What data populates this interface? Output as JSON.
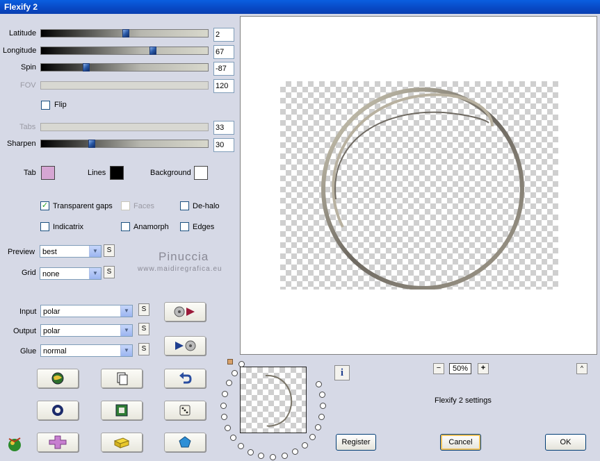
{
  "window": {
    "title": "Flexify 2"
  },
  "sliders": [
    {
      "label": "Latitude",
      "value": "2",
      "position": 0.52,
      "enabled": true
    },
    {
      "label": "Longitude",
      "value": "67",
      "position": 0.68,
      "enabled": true
    },
    {
      "label": "Spin",
      "value": "-87",
      "position": 0.27,
      "enabled": true
    },
    {
      "label": "FOV",
      "value": "120",
      "enabled": false
    },
    {
      "label": "Tabs",
      "value": "33",
      "enabled": false
    },
    {
      "label": "Sharpen",
      "value": "30",
      "position": 0.3,
      "enabled": true
    }
  ],
  "flip": {
    "label": "Flip",
    "checked": false
  },
  "colors": {
    "tab": {
      "label": "Tab",
      "color": "#d6a6d3"
    },
    "lines": {
      "label": "Lines",
      "color": "#000000"
    },
    "background": {
      "label": "Background",
      "color": "#ffffff"
    }
  },
  "options": {
    "transparent_gaps": {
      "label": "Transparent gaps",
      "checked": true
    },
    "faces": {
      "label": "Faces",
      "checked": false,
      "enabled": false
    },
    "de_halo": {
      "label": "De-halo",
      "checked": false
    },
    "indicatrix": {
      "label": "Indicatrix",
      "checked": false
    },
    "anamorph": {
      "label": "Anamorph",
      "checked": false
    },
    "edges": {
      "label": "Edges",
      "checked": false
    }
  },
  "dropdowns": {
    "preview": {
      "label": "Preview",
      "value": "best"
    },
    "grid": {
      "label": "Grid",
      "value": "none"
    },
    "input": {
      "label": "Input",
      "value": "polar"
    },
    "output": {
      "label": "Output",
      "value": "polar"
    },
    "glue": {
      "label": "Glue",
      "value": "normal"
    }
  },
  "small_button_label": "S",
  "watermark": {
    "name": "Pinuccia",
    "site": "www.maidiregrafica.eu"
  },
  "zoom": {
    "minus": "−",
    "value": "50%",
    "plus": "+"
  },
  "settings_label": "Flexify 2 settings",
  "info_label": "i",
  "collapse_label": "^",
  "buttons": {
    "register": "Register",
    "cancel": "Cancel",
    "ok": "OK"
  }
}
